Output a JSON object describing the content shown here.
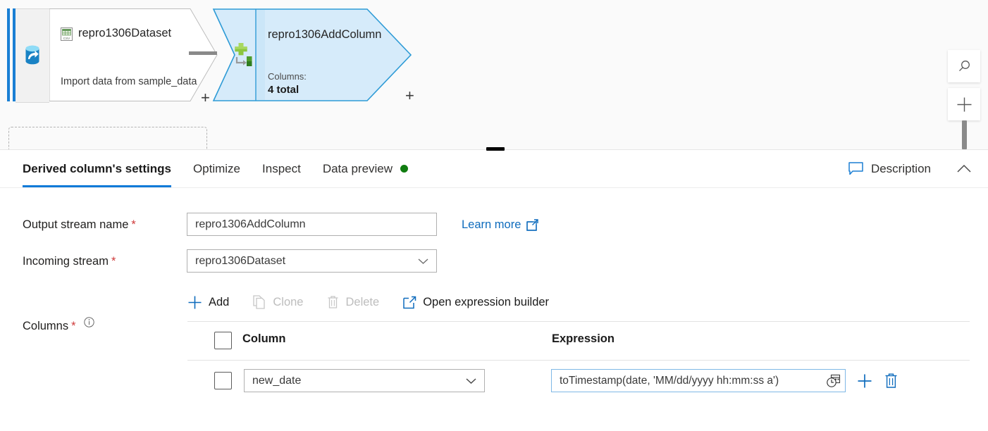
{
  "canvas": {
    "source_node": {
      "title": "repro1306Dataset",
      "subtitle": "Import data from sample_data",
      "title_icon": "csv-file-icon",
      "type_icon": "dataset-source-icon",
      "add_handle": "+"
    },
    "derived_node": {
      "title": "repro1306AddColumn",
      "meta_label": "Columns:",
      "meta_value": "4 total",
      "op_icon": "derived-column-icon",
      "add_handle": "+"
    },
    "controls": {
      "search_icon": "search-icon",
      "zoom_in_icon": "plus-icon"
    },
    "accent_color": "#1a7fd4",
    "selected_fill": "#d6ebfa",
    "selected_stroke": "#2e9bd6"
  },
  "panel": {
    "tabs": [
      {
        "label": "Derived column's settings",
        "active": true,
        "dot": false
      },
      {
        "label": "Optimize",
        "active": false,
        "dot": false
      },
      {
        "label": "Inspect",
        "active": false,
        "dot": false
      },
      {
        "label": "Data preview",
        "active": false,
        "dot": true
      }
    ],
    "tab_accent": "#0f7ad8",
    "dot_color": "#107c10",
    "description_label": "Description",
    "description_icon": "comment-icon",
    "collapse_icon": "chevron-up-icon"
  },
  "form": {
    "output_stream": {
      "label": "Output stream name",
      "required": "*",
      "value": "repro1306AddColumn",
      "placeholder": "Output stream name"
    },
    "incoming_stream": {
      "label": "Incoming stream",
      "required": "*",
      "value": "repro1306Dataset",
      "chevron_icon": "chevron-down-icon"
    },
    "learn_more": {
      "label": "Learn more",
      "icon": "external-link-icon"
    },
    "commands": [
      {
        "label": "Add",
        "icon": "plus-icon",
        "enabled": true
      },
      {
        "label": "Clone",
        "icon": "copy-icon",
        "enabled": false
      },
      {
        "label": "Delete",
        "icon": "trash-icon",
        "enabled": false
      },
      {
        "label": "Open expression builder",
        "icon": "external-link-icon",
        "enabled": true
      }
    ],
    "columns_section": {
      "label": "Columns",
      "required": "*",
      "info_icon": "info-icon"
    },
    "table": {
      "headers": {
        "select_all_checkbox": "select-all-checkbox",
        "column": "Column",
        "expression": "Expression"
      },
      "rows": [
        {
          "checked": false,
          "column": "new_date",
          "column_chevron": "chevron-down-icon",
          "expression": "toTimestamp(date, 'MM/dd/yyyy hh:mm:ss a')",
          "expression_picker_icon": "datetime-picker-icon",
          "add_icon": "plus-icon",
          "delete_icon": "trash-icon"
        }
      ]
    }
  }
}
